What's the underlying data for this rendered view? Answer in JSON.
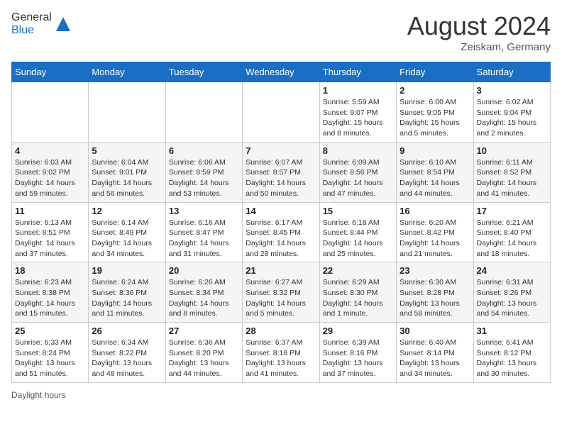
{
  "header": {
    "logo_general": "General",
    "logo_blue": "Blue",
    "month_year": "August 2024",
    "location": "Zeiskam, Germany"
  },
  "weekdays": [
    "Sunday",
    "Monday",
    "Tuesday",
    "Wednesday",
    "Thursday",
    "Friday",
    "Saturday"
  ],
  "weeks": [
    [
      {
        "day": "",
        "info": ""
      },
      {
        "day": "",
        "info": ""
      },
      {
        "day": "",
        "info": ""
      },
      {
        "day": "",
        "info": ""
      },
      {
        "day": "1",
        "info": "Sunrise: 5:59 AM\nSunset: 9:07 PM\nDaylight: 15 hours\nand 8 minutes."
      },
      {
        "day": "2",
        "info": "Sunrise: 6:00 AM\nSunset: 9:05 PM\nDaylight: 15 hours\nand 5 minutes."
      },
      {
        "day": "3",
        "info": "Sunrise: 6:02 AM\nSunset: 9:04 PM\nDaylight: 15 hours\nand 2 minutes."
      }
    ],
    [
      {
        "day": "4",
        "info": "Sunrise: 6:03 AM\nSunset: 9:02 PM\nDaylight: 14 hours\nand 59 minutes."
      },
      {
        "day": "5",
        "info": "Sunrise: 6:04 AM\nSunset: 9:01 PM\nDaylight: 14 hours\nand 56 minutes."
      },
      {
        "day": "6",
        "info": "Sunrise: 6:06 AM\nSunset: 8:59 PM\nDaylight: 14 hours\nand 53 minutes."
      },
      {
        "day": "7",
        "info": "Sunrise: 6:07 AM\nSunset: 8:57 PM\nDaylight: 14 hours\nand 50 minutes."
      },
      {
        "day": "8",
        "info": "Sunrise: 6:09 AM\nSunset: 8:56 PM\nDaylight: 14 hours\nand 47 minutes."
      },
      {
        "day": "9",
        "info": "Sunrise: 6:10 AM\nSunset: 8:54 PM\nDaylight: 14 hours\nand 44 minutes."
      },
      {
        "day": "10",
        "info": "Sunrise: 6:11 AM\nSunset: 8:52 PM\nDaylight: 14 hours\nand 41 minutes."
      }
    ],
    [
      {
        "day": "11",
        "info": "Sunrise: 6:13 AM\nSunset: 8:51 PM\nDaylight: 14 hours\nand 37 minutes."
      },
      {
        "day": "12",
        "info": "Sunrise: 6:14 AM\nSunset: 8:49 PM\nDaylight: 14 hours\nand 34 minutes."
      },
      {
        "day": "13",
        "info": "Sunrise: 6:16 AM\nSunset: 8:47 PM\nDaylight: 14 hours\nand 31 minutes."
      },
      {
        "day": "14",
        "info": "Sunrise: 6:17 AM\nSunset: 8:45 PM\nDaylight: 14 hours\nand 28 minutes."
      },
      {
        "day": "15",
        "info": "Sunrise: 6:18 AM\nSunset: 8:44 PM\nDaylight: 14 hours\nand 25 minutes."
      },
      {
        "day": "16",
        "info": "Sunrise: 6:20 AM\nSunset: 8:42 PM\nDaylight: 14 hours\nand 21 minutes."
      },
      {
        "day": "17",
        "info": "Sunrise: 6:21 AM\nSunset: 8:40 PM\nDaylight: 14 hours\nand 18 minutes."
      }
    ],
    [
      {
        "day": "18",
        "info": "Sunrise: 6:23 AM\nSunset: 8:38 PM\nDaylight: 14 hours\nand 15 minutes."
      },
      {
        "day": "19",
        "info": "Sunrise: 6:24 AM\nSunset: 8:36 PM\nDaylight: 14 hours\nand 11 minutes."
      },
      {
        "day": "20",
        "info": "Sunrise: 6:26 AM\nSunset: 8:34 PM\nDaylight: 14 hours\nand 8 minutes."
      },
      {
        "day": "21",
        "info": "Sunrise: 6:27 AM\nSunset: 8:32 PM\nDaylight: 14 hours\nand 5 minutes."
      },
      {
        "day": "22",
        "info": "Sunrise: 6:29 AM\nSunset: 8:30 PM\nDaylight: 14 hours\nand 1 minute."
      },
      {
        "day": "23",
        "info": "Sunrise: 6:30 AM\nSunset: 8:28 PM\nDaylight: 13 hours\nand 58 minutes."
      },
      {
        "day": "24",
        "info": "Sunrise: 6:31 AM\nSunset: 8:26 PM\nDaylight: 13 hours\nand 54 minutes."
      }
    ],
    [
      {
        "day": "25",
        "info": "Sunrise: 6:33 AM\nSunset: 8:24 PM\nDaylight: 13 hours\nand 51 minutes."
      },
      {
        "day": "26",
        "info": "Sunrise: 6:34 AM\nSunset: 8:22 PM\nDaylight: 13 hours\nand 48 minutes."
      },
      {
        "day": "27",
        "info": "Sunrise: 6:36 AM\nSunset: 8:20 PM\nDaylight: 13 hours\nand 44 minutes."
      },
      {
        "day": "28",
        "info": "Sunrise: 6:37 AM\nSunset: 8:18 PM\nDaylight: 13 hours\nand 41 minutes."
      },
      {
        "day": "29",
        "info": "Sunrise: 6:39 AM\nSunset: 8:16 PM\nDaylight: 13 hours\nand 37 minutes."
      },
      {
        "day": "30",
        "info": "Sunrise: 6:40 AM\nSunset: 8:14 PM\nDaylight: 13 hours\nand 34 minutes."
      },
      {
        "day": "31",
        "info": "Sunrise: 6:41 AM\nSunset: 8:12 PM\nDaylight: 13 hours\nand 30 minutes."
      }
    ]
  ],
  "footer": {
    "daylight_label": "Daylight hours"
  }
}
